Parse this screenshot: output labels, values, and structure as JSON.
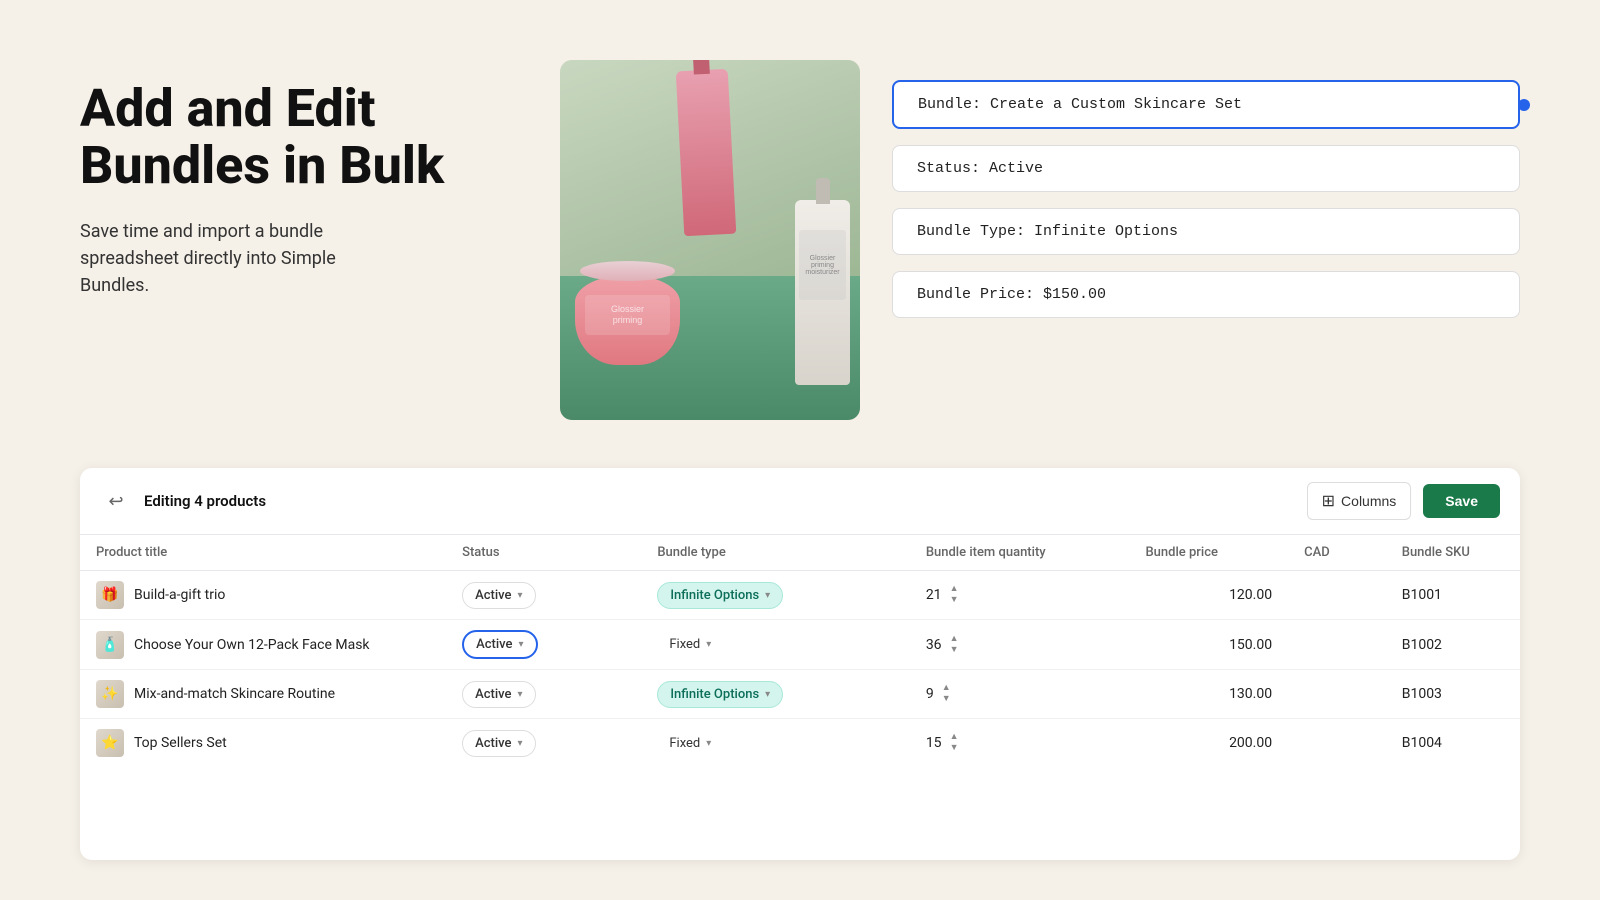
{
  "hero": {
    "title": "Add and Edit\nBundles in Bulk",
    "subtitle": "Save time and import a bundle\nspreadsheet directly into Simple\nBundles."
  },
  "info_cards": [
    {
      "id": "name-card",
      "text": "Bundle: Create a Custom Skincare Set",
      "highlighted": true
    },
    {
      "id": "status-card",
      "text": "Status: Active",
      "highlighted": false
    },
    {
      "id": "type-card",
      "text": "Bundle Type: Infinite Options",
      "highlighted": false
    },
    {
      "id": "price-card",
      "text": "Bundle Price: $150.00",
      "highlighted": false
    }
  ],
  "table": {
    "header": {
      "editing_label": "Editing 4 products",
      "columns_btn": "Columns",
      "save_btn": "Save"
    },
    "columns": [
      "Product title",
      "Status",
      "Bundle type",
      "Bundle item quantity",
      "Bundle price",
      "CAD",
      "Bundle SKU"
    ],
    "rows": [
      {
        "id": "row-1",
        "product_icon": "🎁",
        "product_title": "Build-a-gift trio",
        "status": "Active",
        "status_highlighted": false,
        "bundle_type": "Infinite Options",
        "bundle_type_style": "teal",
        "qty": 21,
        "price": "120.00",
        "sku": "B1001"
      },
      {
        "id": "row-2",
        "product_icon": "🧴",
        "product_title": "Choose Your Own 12-Pack Face Mask",
        "status": "Active",
        "status_highlighted": true,
        "bundle_type": "Fixed",
        "bundle_type_style": "plain",
        "qty": 36,
        "price": "150.00",
        "sku": "B1002"
      },
      {
        "id": "row-3",
        "product_icon": "✨",
        "product_title": "Mix-and-match Skincare Routine",
        "status": "Active",
        "status_highlighted": false,
        "bundle_type": "Infinite Options",
        "bundle_type_style": "teal",
        "qty": 9,
        "price": "130.00",
        "sku": "B1003"
      },
      {
        "id": "row-4",
        "product_icon": "⭐",
        "product_title": "Top Sellers Set",
        "status": "Active",
        "status_highlighted": false,
        "bundle_type": "Fixed",
        "bundle_type_style": "plain",
        "qty": 15,
        "price": "200.00",
        "sku": "B1004"
      }
    ]
  },
  "icons": {
    "back": "↩",
    "columns": "⊞",
    "chevron_down": "▾",
    "arrow_up": "▲",
    "arrow_down": "▼"
  }
}
